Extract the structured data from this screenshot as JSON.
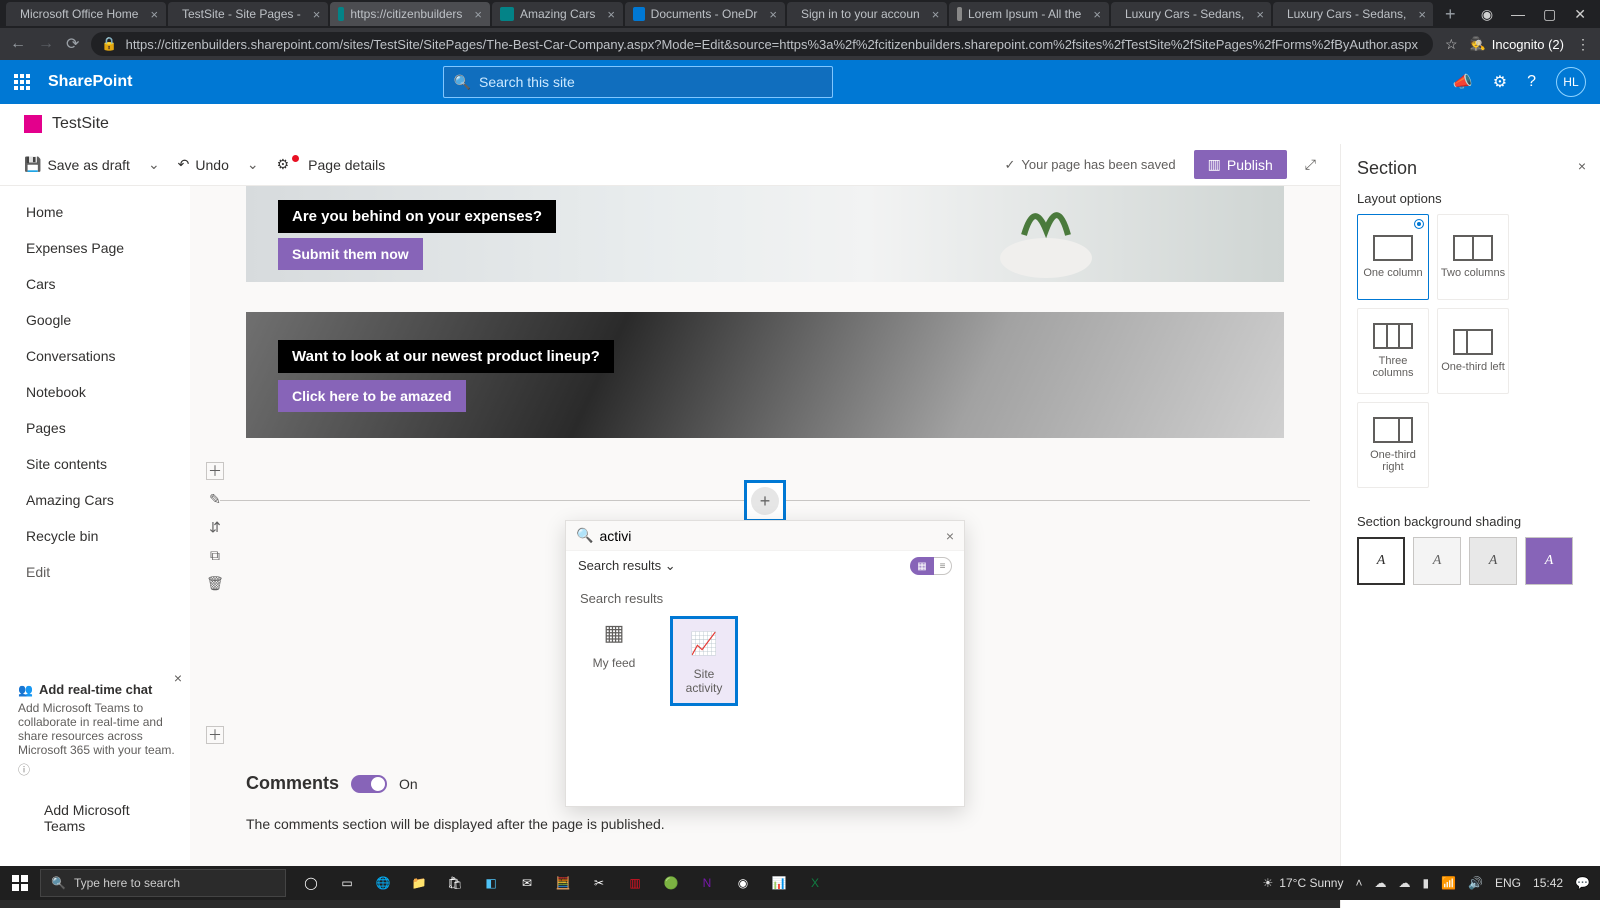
{
  "browser": {
    "tabs": [
      {
        "label": "Microsoft Office Home",
        "fav": "#d83b01"
      },
      {
        "label": "TestSite - Site Pages -",
        "fav": "#038387"
      },
      {
        "label": "https://citizenbuilders",
        "fav": "#038387",
        "active": true
      },
      {
        "label": "Amazing Cars",
        "fav": "#038387"
      },
      {
        "label": "Documents - OneDr",
        "fav": "#0078d4"
      },
      {
        "label": "Sign in to your accoun",
        "fav": "#7fba00"
      },
      {
        "label": "Lorem Ipsum - All the",
        "fav": "#888"
      },
      {
        "label": "Luxury Cars - Sedans,",
        "fav": "#777"
      },
      {
        "label": "Luxury Cars - Sedans,",
        "fav": "#777"
      }
    ],
    "url": "https://citizenbuilders.sharepoint.com/sites/TestSite/SitePages/The-Best-Car-Company.aspx?Mode=Edit&source=https%3a%2f%2fcitizenbuilders.sharepoint.com%2fsites%2fTestSite%2fSitePages%2fForms%2fByAuthor.aspx",
    "incognito": "Incognito (2)"
  },
  "suite": {
    "product": "SharePoint",
    "search_placeholder": "Search this site",
    "avatar": "HL"
  },
  "site": {
    "name": "TestSite"
  },
  "nav": [
    "Home",
    "Expenses Page",
    "Cars",
    "Google",
    "Conversations",
    "Notebook",
    "Pages",
    "Site contents",
    "Amazing Cars",
    "Recycle bin",
    "Edit"
  ],
  "teams": {
    "title": "Add real-time chat",
    "body": "Add Microsoft Teams to collaborate in real-time and share resources across Microsoft 365 with your team.",
    "link": "Add Microsoft Teams"
  },
  "cmd": {
    "save": "Save as draft",
    "undo": "Undo",
    "details": "Page details",
    "status": "Your page has been saved",
    "publish": "Publish"
  },
  "heroes": [
    {
      "tag": "Are you behind on your expenses?",
      "btn": "Submit them now"
    },
    {
      "tag": "Want to look at our newest product lineup?",
      "btn": "Click here to be amazed"
    }
  ],
  "picker": {
    "query": "activi",
    "tab": "Search results",
    "heading": "Search results",
    "items": [
      {
        "label": "My feed"
      },
      {
        "label": "Site activity",
        "selected": true
      }
    ]
  },
  "comments": {
    "title": "Comments",
    "state": "On",
    "note": "The comments section will be displayed after the page is published."
  },
  "panel": {
    "title": "Section",
    "layout_label": "Layout options",
    "layouts": [
      {
        "label": "One column",
        "selected": true,
        "cols": 1
      },
      {
        "label": "Two columns",
        "cols": 2
      },
      {
        "label": "Three columns",
        "cols": 3
      },
      {
        "label": "One-third left",
        "cols": "tl"
      },
      {
        "label": "One-third right",
        "cols": "tr"
      }
    ],
    "shade_label": "Section background shading"
  },
  "taskbar": {
    "search": "Type here to search",
    "weather": "17°C  Sunny",
    "lang": "ENG",
    "time": "15:42"
  }
}
